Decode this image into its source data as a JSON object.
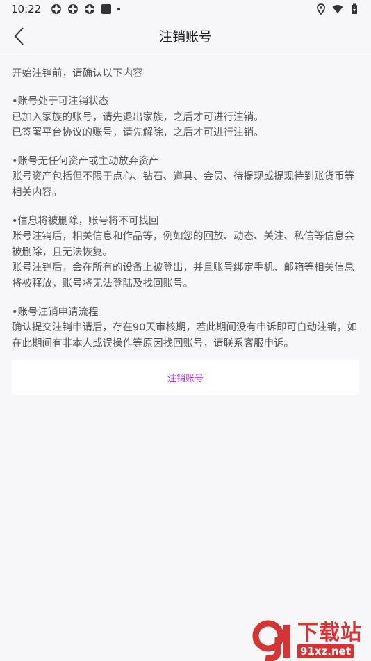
{
  "status_bar": {
    "time": "10:22"
  },
  "nav": {
    "title": "注销账号"
  },
  "content": {
    "intro": "开始注销前，请确认以下内容",
    "sections": [
      {
        "heading": "•账号处于可注销状态",
        "lines": [
          "已加入家族的账号，请先退出家族，之后才可进行注销。",
          "已签署平台协议的账号，请先解除，之后才可进行注销。"
        ]
      },
      {
        "heading": "•账号无任何资产或主动放弃资产",
        "lines": [
          "账号资产包括但不限于点心、钻石、道具、会员、待提现或提现待到账货币等相关内容。"
        ]
      },
      {
        "heading": "•信息将被删除，账号将不可找回",
        "lines": [
          "账号注销后，相关信息和作品等，例如您的回放、动态、关注、私信等信息会被删除，且无法恢复。",
          "账号注销后，会在所有的设备上被登出，并且账号绑定手机、邮箱等相关信息将被释放，账号将无法登陆及找回账号。"
        ]
      },
      {
        "heading": "•账号注销申请流程",
        "lines": [
          "确认提交注销申请后，存在90天审核期，若此期间没有申诉即可自动注销，如在此期间有非本人或误操作等原因找回账号，请联系客服申诉。"
        ]
      }
    ],
    "confirm_button": "注销账号"
  },
  "watermark": {
    "brand": "下载站",
    "url": "91xz.net"
  },
  "colors": {
    "accent": "#a23de0",
    "watermark": "#d42a2a"
  }
}
